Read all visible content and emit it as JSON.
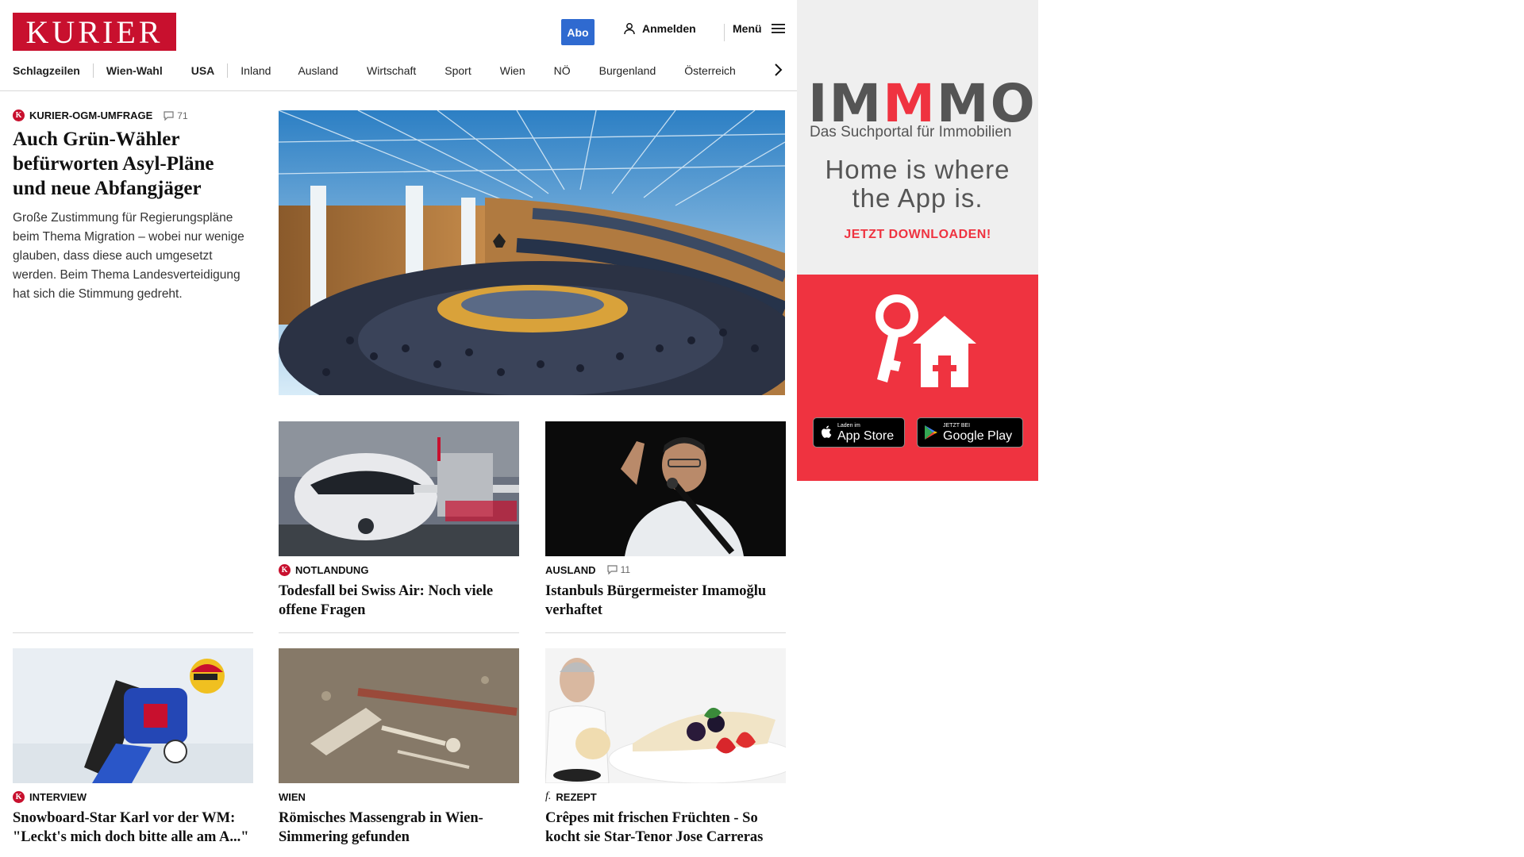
{
  "header": {
    "logo": "KURIER",
    "abo_label": "Abo",
    "login_label": "Anmelden",
    "menu_label": "Menü",
    "nav": [
      "Schlagzeilen",
      "Wien-Wahl",
      "USA",
      "Inland",
      "Ausland",
      "Wirtschaft",
      "Sport",
      "Wien",
      "NÖ",
      "Burgenland",
      "Österreich"
    ]
  },
  "lead": {
    "kicker": "KURIER-OGM-UMFRAGE",
    "comments": "71",
    "title": "Auch Grün-Wähler befürworten Asyl-Pläne und neue Abfangjäger",
    "teaser": "Große Zustimmung für Regierungspläne beim Thema Migration – wobei nur wenige glauben, dass diese auch umgesetzt werden. Beim Thema Landesverteidigung hat sich die Stimmung gedreht."
  },
  "cards": [
    {
      "kicker": "NOTLANDUNG",
      "badge": "K",
      "comments": "",
      "title": "Todesfall bei Swiss Air: Noch viele offene Fragen"
    },
    {
      "kicker": "AUSLAND",
      "badge": "",
      "comments": "11",
      "title": "Istanbuls Bürgermeister Imamoğlu verhaftet"
    },
    {
      "kicker": "INTERVIEW",
      "badge": "K",
      "comments": "",
      "title": "Snowboard-Star Karl vor der WM: \"Leckt's mich doch bitte alle am A...\""
    },
    {
      "kicker": "WIEN",
      "badge": "",
      "comments": "",
      "title": "Römisches Massengrab in Wien-Simmering gefunden"
    },
    {
      "kicker": "REZEPT",
      "badge": "f.",
      "comments": "",
      "title": "Crêpes mit frischen Früchten - So kocht sie Star-Tenor Jose Carreras"
    }
  ],
  "ad": {
    "brand_a": "IM",
    "brand_m": "M",
    "brand_b": "MO",
    "subtitle": "Das Suchportal für Immobilien",
    "headline_1": "Home is where",
    "headline_2": "the App is.",
    "cta": "JETZT DOWNLOADEN!",
    "appstore_small": "Laden im",
    "appstore_big": "App Store",
    "play_small": "JETZT BEI",
    "play_big": "Google Play"
  },
  "colors": {
    "brand_red": "#c8102e",
    "abo_blue": "#2f6ad0",
    "ad_red": "#ef3340"
  }
}
